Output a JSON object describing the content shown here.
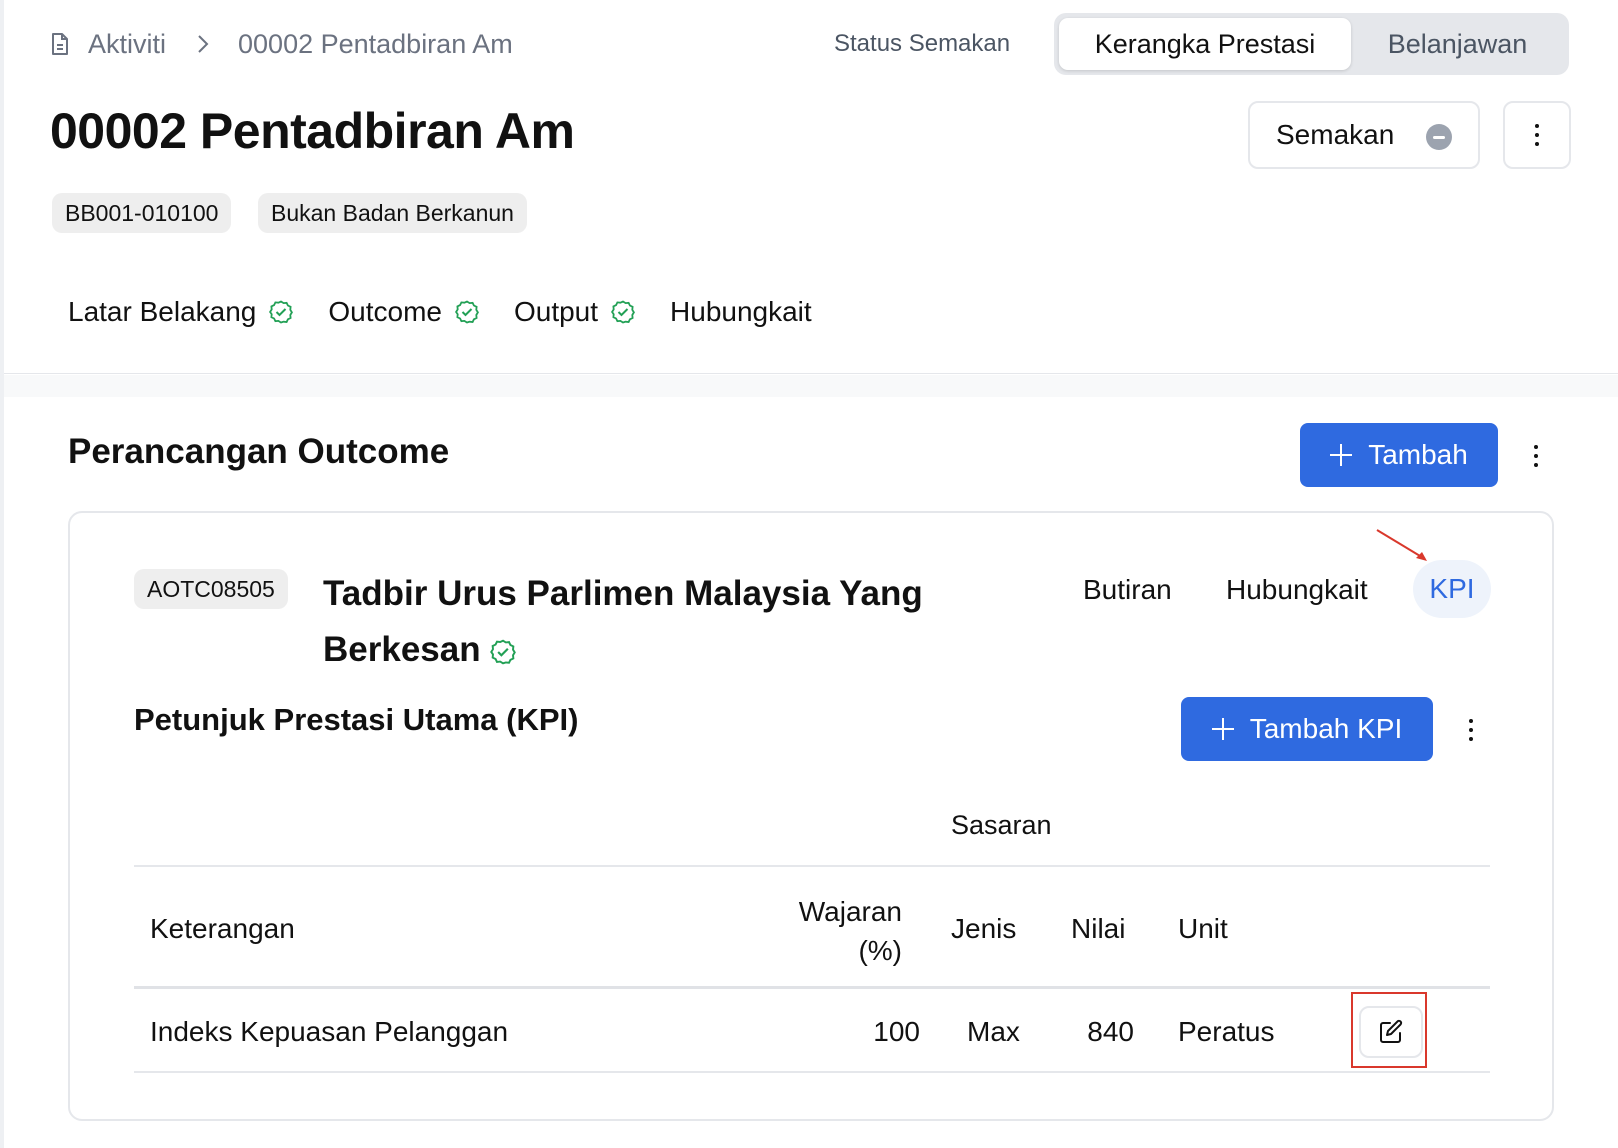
{
  "breadcrumb": {
    "home": "Aktiviti",
    "current": "00002 Pentadbiran Am"
  },
  "header": {
    "status_label": "Status Semakan",
    "view_toggle": [
      "Kerangka Prestasi",
      "Belanjawan"
    ],
    "title": "00002 Pentadbiran Am",
    "review_button": "Semakan",
    "badges": [
      "BB001-010100",
      "Bukan Badan Berkanun"
    ]
  },
  "tabs": [
    {
      "label": "Latar Belakang",
      "complete": true
    },
    {
      "label": "Outcome",
      "complete": true
    },
    {
      "label": "Output",
      "complete": true
    },
    {
      "label": "Hubungkait",
      "complete": false
    }
  ],
  "section": {
    "title": "Perancangan Outcome",
    "add_button": "Tambah"
  },
  "outcome_card": {
    "code": "AOTC08505",
    "title": "Tadbir Urus Parlimen Malaysia Yang Berkesan",
    "tabs": [
      "Butiran",
      "Hubungkait",
      "KPI"
    ],
    "active_tab": "KPI"
  },
  "kpi": {
    "title": "Petunjuk Prestasi Utama (KPI)",
    "add_button": "Tambah KPI",
    "group_header": "Sasaran",
    "columns": {
      "keterangan": "Keterangan",
      "wajaran": "Wajaran (%)",
      "jenis": "Jenis",
      "nilai": "Nilai",
      "unit": "Unit"
    },
    "rows": [
      {
        "keterangan": "Indeks Kepuasan Pelanggan",
        "wajaran": "100",
        "jenis": "Max",
        "nilai": "840",
        "unit": "Peratus"
      }
    ]
  },
  "colors": {
    "primary": "#2f6ae0",
    "success": "#22a055",
    "annotation": "#d9382c"
  }
}
